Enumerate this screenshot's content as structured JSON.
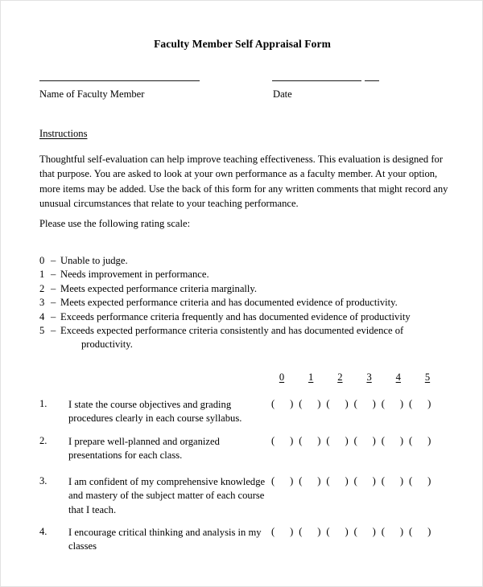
{
  "document": {
    "title": "Faculty Member Self Appraisal Form"
  },
  "signature": {
    "name_label": "Name of Faculty Member",
    "date_label": "Date"
  },
  "instructions": {
    "heading": "Instructions",
    "body": "Thoughtful self-evaluation can help improve teaching effectiveness.  This evaluation is designed for that purpose.  You are asked to look at your own performance as a faculty member.  At your option, more items may be added.  Use the back of this form for any written comments that might record any unusual circumstances that relate to your teaching performance."
  },
  "rating_scale": {
    "intro": "Please use the following rating scale:",
    "items": [
      {
        "value": "0",
        "dash": "–",
        "text": "Unable to judge."
      },
      {
        "value": "1",
        "dash": "–",
        "text": "Needs improvement in performance."
      },
      {
        "value": "2",
        "dash": "–",
        "text": "Meets expected performance criteria marginally."
      },
      {
        "value": "3",
        "dash": "–",
        "text": "Meets expected performance criteria and has documented evidence of productivity."
      },
      {
        "value": "4",
        "dash": "–",
        "text": "Exceeds performance criteria frequently and has documented evidence of productivity"
      },
      {
        "value": "5",
        "dash": "–",
        "text": "Exceeds expected performance criteria consistently and has documented evidence of",
        "continuation": "productivity."
      }
    ]
  },
  "ratings_table": {
    "column_headers": [
      "0",
      "1",
      "2",
      "3",
      "4",
      "5"
    ],
    "option_marker": "(      )",
    "questions": [
      {
        "number": "1.",
        "text": "I state the course objectives and grading procedures clearly in each course syllabus."
      },
      {
        "number": "2.",
        "text": "I prepare well-planned and organized presentations for each class."
      },
      {
        "number": "3.",
        "text": "I am confident of my comprehensive knowledge and mastery of the subject matter of each course that I teach."
      },
      {
        "number": "4.",
        "text": "I encourage critical thinking and analysis in my classes"
      }
    ]
  }
}
